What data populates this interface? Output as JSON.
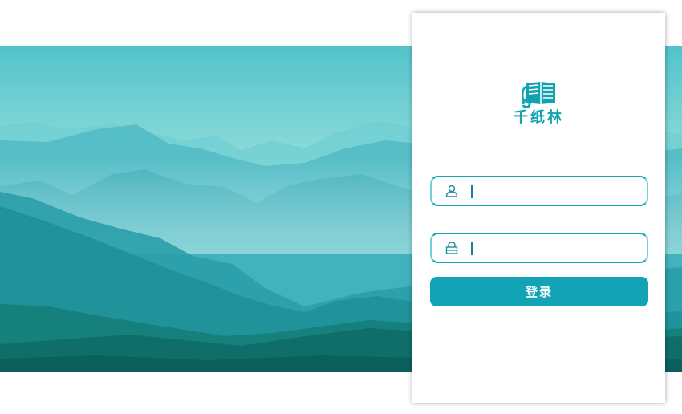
{
  "brand": {
    "name": "千纸林",
    "logo_icon": "book-scroll-icon",
    "color": "#12a3b0"
  },
  "form": {
    "username": {
      "icon": "user-icon",
      "value": "",
      "placeholder": ""
    },
    "password": {
      "icon": "lock-icon",
      "value": "",
      "placeholder": ""
    },
    "login_label": "登录"
  },
  "colors": {
    "accent": "#12a3b6",
    "banner_top": "#5cc9d0",
    "banner_bottom": "#0d6f6a"
  }
}
